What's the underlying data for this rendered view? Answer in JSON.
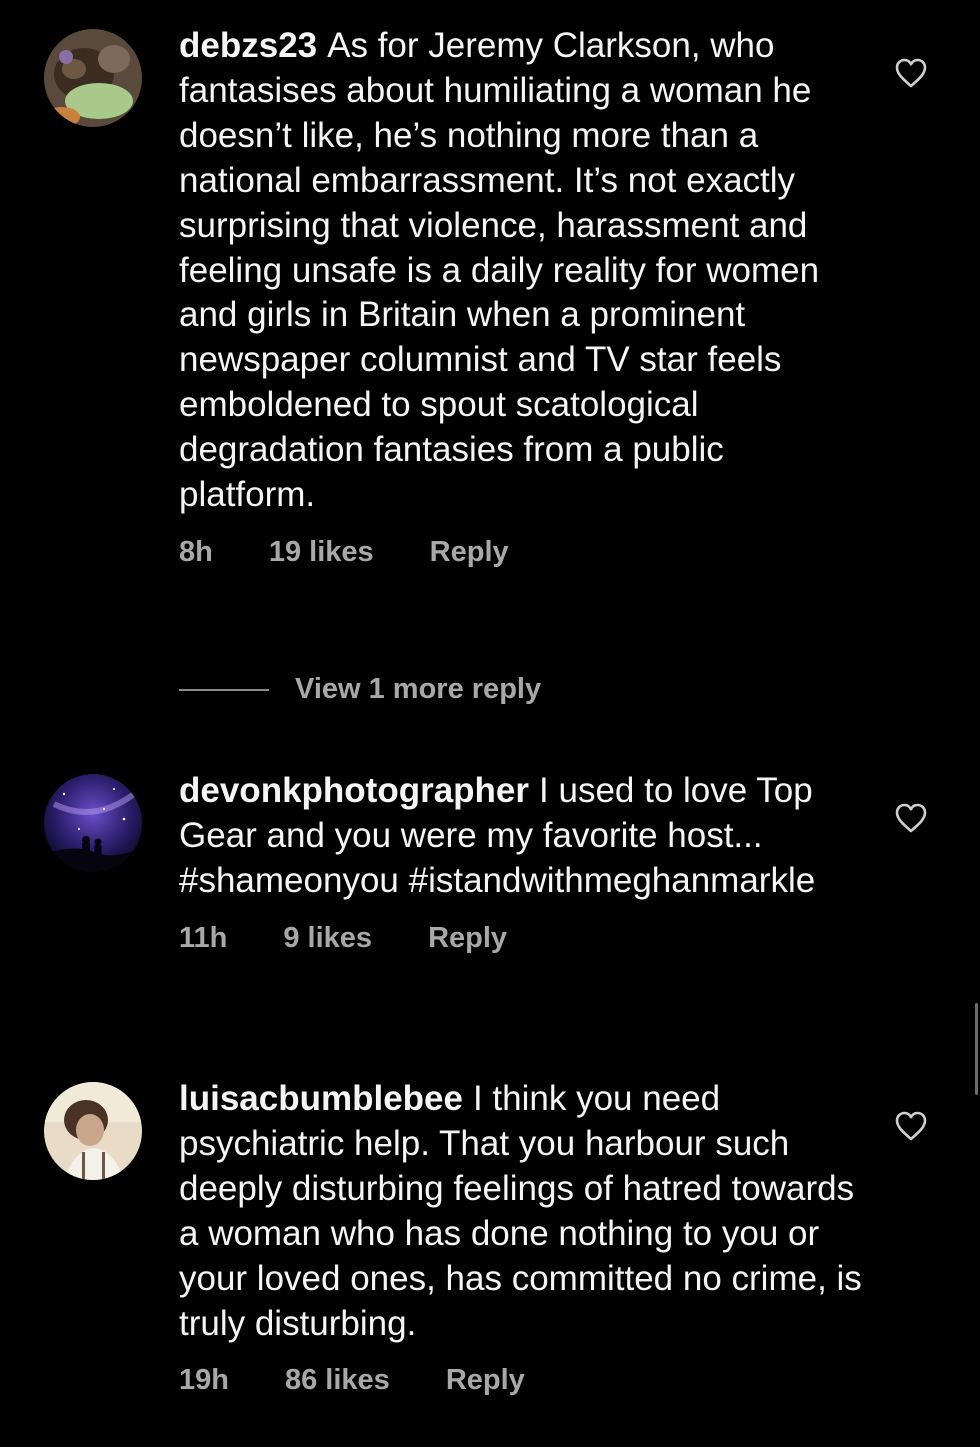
{
  "comments": [
    {
      "username": "debzs23",
      "text": "As for Jeremy Clarkson, who fantasises about humiliating a woman he doesn’t like, he’s nothing more than a national embarrassment. It’s not exactly surprising that violence, harassment and feeling unsafe is a daily reality for women and girls in Britain when a prominent newspaper columnist and TV star feels emboldened to spout scatological degradation fantasies from a public platform.",
      "time": "8h",
      "likes": "19 likes",
      "reply_label": "Reply",
      "avatar": "dog-photo-avatar"
    },
    {
      "username": "devonkphotographer",
      "text": "I used to love Top Gear and you were my favorite host... #shameonyou #istandwithmeghanmarkle",
      "time": "11h",
      "likes": "9 likes",
      "reply_label": "Reply",
      "avatar": "night-sky-avatar"
    },
    {
      "username": "luisacbumblebee",
      "text": "I think you need psychiatric help. That you harbour such deeply disturbing feelings of hatred towards a woman who has done nothing to you  or your loved ones, has committed no crime, is truly disturbing.",
      "time": "19h",
      "likes": "86 likes",
      "reply_label": "Reply",
      "avatar": "person-photo-avatar"
    }
  ],
  "view_more_replies": "View 1 more reply",
  "icons": {
    "like": "heart-outline-icon"
  },
  "colors": {
    "background": "#000000",
    "text": "#f5f5f5",
    "secondary": "#a8a8a8"
  }
}
